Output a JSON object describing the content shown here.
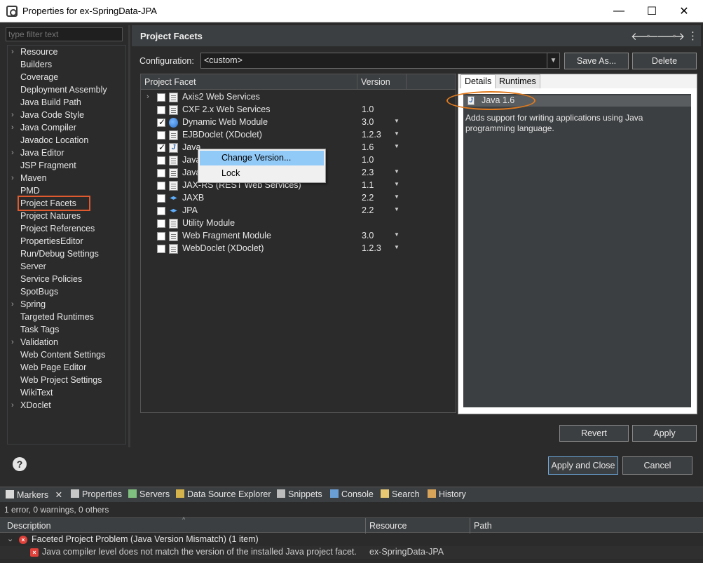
{
  "window": {
    "title": "Properties for ex-SpringData-JPA",
    "minimize": "—",
    "maximize": "☐",
    "close": "✕"
  },
  "filter": {
    "placeholder": "type filter text"
  },
  "tree": {
    "items": [
      {
        "label": "Resource",
        "expandable": true
      },
      {
        "label": "Builders",
        "expandable": false
      },
      {
        "label": "Coverage",
        "expandable": false
      },
      {
        "label": "Deployment Assembly",
        "expandable": false
      },
      {
        "label": "Java Build Path",
        "expandable": false
      },
      {
        "label": "Java Code Style",
        "expandable": true
      },
      {
        "label": "Java Compiler",
        "expandable": true
      },
      {
        "label": "Javadoc Location",
        "expandable": false
      },
      {
        "label": "Java Editor",
        "expandable": true
      },
      {
        "label": "JSP Fragment",
        "expandable": false
      },
      {
        "label": "Maven",
        "expandable": true
      },
      {
        "label": "PMD",
        "expandable": false
      },
      {
        "label": "Project Facets",
        "expandable": false,
        "selected": true
      },
      {
        "label": "Project Natures",
        "expandable": false
      },
      {
        "label": "Project References",
        "expandable": false
      },
      {
        "label": "PropertiesEditor",
        "expandable": false
      },
      {
        "label": "Run/Debug Settings",
        "expandable": false
      },
      {
        "label": "Server",
        "expandable": false
      },
      {
        "label": "Service Policies",
        "expandable": false
      },
      {
        "label": "SpotBugs",
        "expandable": false
      },
      {
        "label": "Spring",
        "expandable": true
      },
      {
        "label": "Targeted Runtimes",
        "expandable": false
      },
      {
        "label": "Task Tags",
        "expandable": false
      },
      {
        "label": "Validation",
        "expandable": true
      },
      {
        "label": "Web Content Settings",
        "expandable": false
      },
      {
        "label": "Web Page Editor",
        "expandable": false
      },
      {
        "label": "Web Project Settings",
        "expandable": false
      },
      {
        "label": "WikiText",
        "expandable": false
      },
      {
        "label": "XDoclet",
        "expandable": true
      }
    ]
  },
  "page": {
    "title": "Project Facets",
    "back_icon": "🡐",
    "forward_icon": "🡒",
    "menu_icon": "⋮",
    "configuration_label": "Configuration:",
    "configuration_value": "<custom>",
    "save_as": "Save As...",
    "delete": "Delete"
  },
  "facets": {
    "col_facet": "Project Facet",
    "col_version": "Version",
    "rows": [
      {
        "name": "Axis2 Web Services",
        "version": "",
        "checked": false,
        "icon": "doc",
        "expandable": true,
        "dropdown": false
      },
      {
        "name": "CXF 2.x Web Services",
        "version": "1.0",
        "checked": false,
        "icon": "doc",
        "expandable": false,
        "dropdown": false
      },
      {
        "name": "Dynamic Web Module",
        "version": "3.0",
        "checked": true,
        "icon": "globe",
        "expandable": false,
        "dropdown": true
      },
      {
        "name": "EJBDoclet (XDoclet)",
        "version": "1.2.3",
        "checked": false,
        "icon": "doc",
        "expandable": false,
        "dropdown": true
      },
      {
        "name": "Java",
        "version": "1.6",
        "checked": true,
        "icon": "java",
        "expandable": false,
        "dropdown": true
      },
      {
        "name": "Java",
        "version": "1.0",
        "checked": false,
        "icon": "doc",
        "expandable": false,
        "dropdown": false
      },
      {
        "name": "Java",
        "version": "2.3",
        "checked": false,
        "icon": "doc",
        "expandable": false,
        "dropdown": true
      },
      {
        "name": "JAX-RS (REST Web Services)",
        "version": "1.1",
        "checked": false,
        "icon": "doc",
        "expandable": false,
        "dropdown": true
      },
      {
        "name": "JAXB",
        "version": "2.2",
        "checked": false,
        "icon": "diamond",
        "expandable": false,
        "dropdown": true
      },
      {
        "name": "JPA",
        "version": "2.2",
        "checked": false,
        "icon": "diamond",
        "expandable": false,
        "dropdown": true
      },
      {
        "name": "Utility Module",
        "version": "",
        "checked": false,
        "icon": "doc",
        "expandable": false,
        "dropdown": false
      },
      {
        "name": "Web Fragment Module",
        "version": "3.0",
        "checked": false,
        "icon": "doc",
        "expandable": false,
        "dropdown": true
      },
      {
        "name": "WebDoclet (XDoclet)",
        "version": "1.2.3",
        "checked": false,
        "icon": "doc",
        "expandable": false,
        "dropdown": true
      }
    ]
  },
  "context_menu": {
    "items": [
      "Change Version...",
      "Lock"
    ]
  },
  "details": {
    "tab_details": "Details",
    "tab_runtimes": "Runtimes",
    "facet_title": "Java 1.6",
    "description": "Adds support for writing applications using Java programming language."
  },
  "buttons": {
    "revert": "Revert",
    "apply": "Apply",
    "apply_close": "Apply and Close",
    "cancel": "Cancel",
    "help": "?"
  },
  "views": {
    "tabs": [
      "Markers",
      "Properties",
      "Servers",
      "Data Source Explorer",
      "Snippets",
      "Console",
      "Search",
      "History"
    ],
    "status": "1 error, 0 warnings, 0 others",
    "columns": [
      "Description",
      "Resource",
      "Path"
    ],
    "group": "Faceted Project Problem (Java Version Mismatch) (1 item)",
    "problem": {
      "description": "Java compiler level does not match the version of the installed Java project facet.",
      "resource": "ex-SpringData-JPA",
      "path": ""
    }
  },
  "colors": {
    "accent_selection": "#e05a2f",
    "annotation_oval": "#e07a1f",
    "menu_highlight": "#91c9f7",
    "error": "#e0413a"
  }
}
